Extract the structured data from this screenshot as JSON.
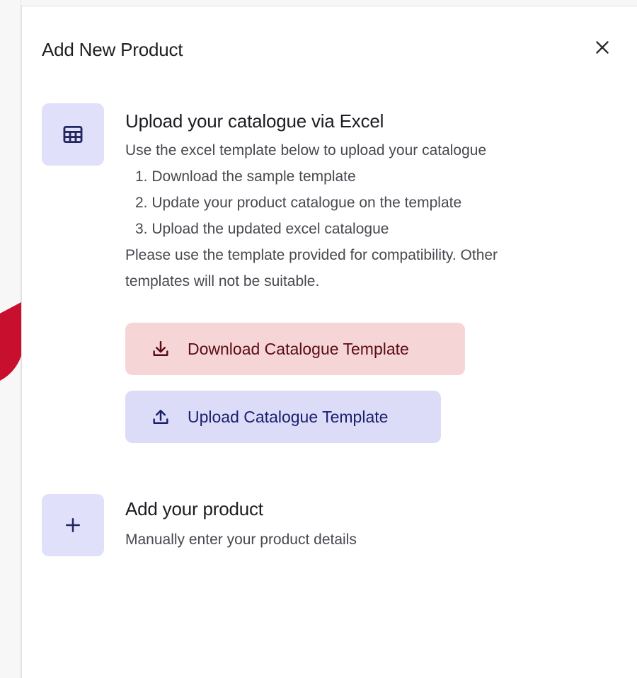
{
  "panel": {
    "title": "Add New Product",
    "close_icon": "close-icon"
  },
  "excel_section": {
    "icon": "table-icon",
    "title": "Upload your catalogue via Excel",
    "description": "Use the excel template below to upload your catalogue",
    "steps": [
      "1. Download the sample template",
      "2. Update your product catalogue on the template",
      "3. Upload the updated excel catalogue"
    ],
    "note_line1": "Please use the template provided for compatibility. Other",
    "note_line2": "templates will not be suitable.",
    "download_button": {
      "label": "Download Catalogue Template",
      "icon": "download-icon"
    },
    "upload_button": {
      "label": "Upload Catalogue Template",
      "icon": "upload-icon"
    }
  },
  "manual_section": {
    "icon": "plus-icon",
    "title": "Add your product",
    "description": "Manually enter your product details"
  },
  "colors": {
    "tile_bg": "#e0e0fa",
    "download_bg": "#f6d5d7",
    "upload_bg": "#dcdcf9",
    "accent_red": "#c8102e"
  }
}
